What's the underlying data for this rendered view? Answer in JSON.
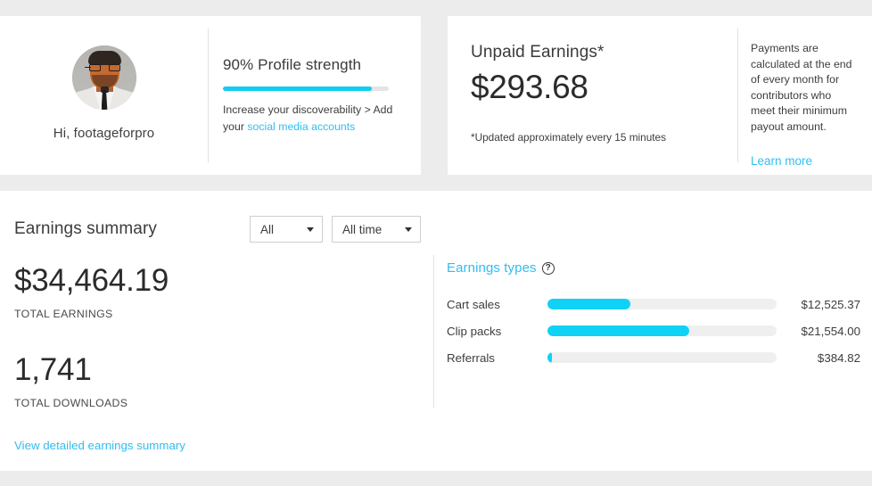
{
  "profile": {
    "avatar_alt": "user-avatar-photo",
    "greeting": "Hi, footageforpro",
    "strength_title": "90% Profile strength",
    "strength_percent": 90,
    "sub_text_lead": "Increase your discoverability > Add your ",
    "sub_link": "social media accounts"
  },
  "unpaid": {
    "title": "Unpaid Earnings*",
    "amount": "$293.68",
    "note": "*Updated approximately every 15 minutes",
    "blurb": "Payments are calculated at the end of every month for contributors who meet their minimum payout amount.",
    "learn_more": "Learn more"
  },
  "summary": {
    "title": "Earnings summary",
    "filter_type": "All",
    "filter_time": "All time",
    "total_earnings_value": "$34,464.19",
    "total_earnings_label": "TOTAL EARNINGS",
    "total_downloads_value": "1,741",
    "total_downloads_label": "TOTAL DOWNLOADS",
    "detail_link": "View detailed earnings summary"
  },
  "chart_data": {
    "type": "bar",
    "title": "Earnings types",
    "orientation": "horizontal",
    "help_glyph": "?",
    "categories": [
      "Cart sales",
      "Clip packs",
      "Referrals"
    ],
    "values": [
      12525.37,
      21554.0,
      384.82
    ],
    "value_labels": [
      "$12,525.37",
      "$21,554.00",
      "$384.82"
    ],
    "fill_percents": [
      36,
      62,
      2
    ],
    "xlabel": "",
    "ylabel": "",
    "xlim": [
      0,
      34464.19
    ],
    "grid": false,
    "legend": false
  },
  "colors": {
    "accent_cyan": "#0fd2f6",
    "link_blue": "#31bdf0",
    "page_bg": "#ececec",
    "card_bg": "#ffffff",
    "track_gray": "#efefef"
  }
}
